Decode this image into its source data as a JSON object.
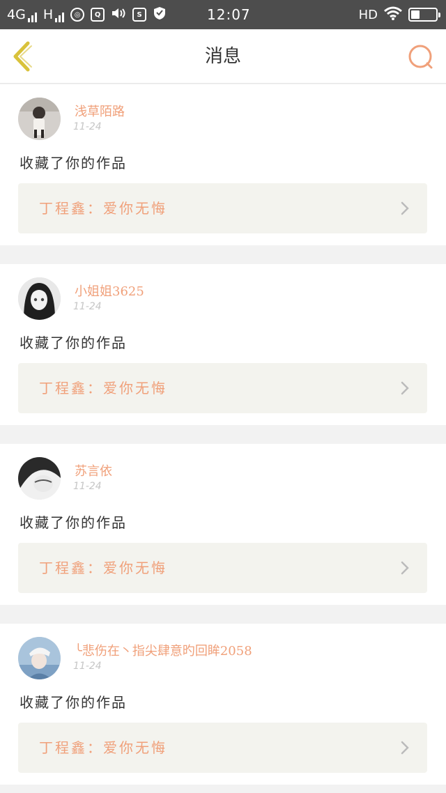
{
  "status_bar": {
    "network_1": "4G",
    "network_2": "H",
    "time": "12:07",
    "hd": "HD"
  },
  "header": {
    "title": "消息",
    "back_icon": "chevron-left-icon",
    "search_icon": "search-icon"
  },
  "colors": {
    "accent": "#f0a07a",
    "back_icon": "#d9c23b",
    "card_bg": "#ffffff",
    "work_bg": "#f3f3ee",
    "page_bg": "#f2f2f2"
  },
  "messages": [
    {
      "user": "浅草陌路",
      "date": "11-24",
      "action": "收藏了你的作品",
      "work": "丁程鑫：爱你无悔"
    },
    {
      "user": "小姐姐3625",
      "date": "11-24",
      "action": "收藏了你的作品",
      "work": "丁程鑫：爱你无悔"
    },
    {
      "user": "苏言依",
      "date": "11-24",
      "action": "收藏了你的作品",
      "work": "丁程鑫：爱你无悔"
    },
    {
      "user": "╰悲伤在丶指尖肆意旳回眸2058",
      "date": "11-24",
      "action": "收藏了你的作品",
      "work": "丁程鑫：爱你无悔"
    }
  ]
}
